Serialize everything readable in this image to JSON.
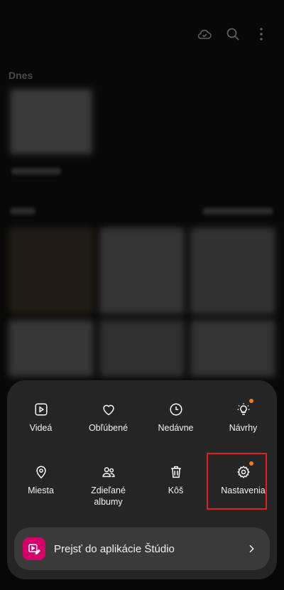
{
  "gallery": {
    "section_title": "Dnes"
  },
  "menu": {
    "items": [
      {
        "label": "Videá",
        "icon": "play-box-icon"
      },
      {
        "label": "Obľúbené",
        "icon": "heart-icon"
      },
      {
        "label": "Nedávne",
        "icon": "clock-icon"
      },
      {
        "label": "Návrhy",
        "icon": "lightbulb-icon"
      },
      {
        "label": "Miesta",
        "icon": "location-pin-icon"
      },
      {
        "label": "Zdieľané albumy",
        "icon": "people-icon"
      },
      {
        "label": "Kôš",
        "icon": "trash-icon"
      },
      {
        "label": "Nastavenia",
        "icon": "gear-icon"
      }
    ],
    "studio_label": "Prejsť do aplikácie Štúdio"
  },
  "colors": {
    "accent_dot": "#f07a1f",
    "studio_brand": "#d6006b",
    "highlight": "#e02020"
  }
}
